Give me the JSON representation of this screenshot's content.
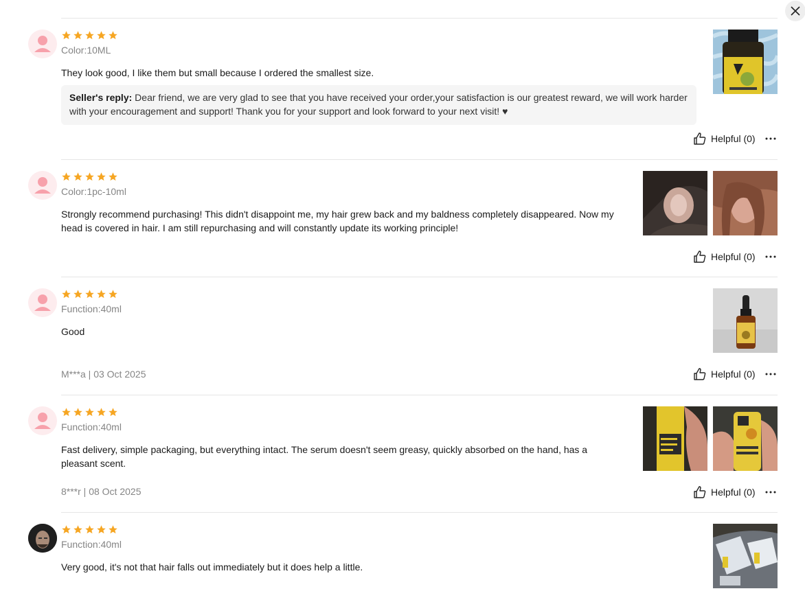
{
  "close_label": "close",
  "reviews": [
    {
      "rating": 5,
      "sku": "Color:10ML",
      "text": "They look good, I like them but small because I ordered the smallest size.",
      "reply_label": "Seller's reply:",
      "reply_text": "Dear friend, we are very glad to see that you have received your order,your satisfaction is our greatest reward, we will work harder with your encouragement and support! Thank you for your support and look forward to your next visit! ♥",
      "meta": "",
      "helpful": "Helpful (0)",
      "photos": [
        "bottle-on-blanket-photo"
      ]
    },
    {
      "rating": 5,
      "sku": "Color:1pc-10ml",
      "text_line1": "Strongly recommend purchasing! This didn't disappoint me, my hair grew back and my baldness completely disappeared. Now my",
      "text_line2": "head is covered in hair. I am still repurchasing and will constantly update its working principle!",
      "meta": "",
      "helpful": "Helpful (0)",
      "photos": [
        "scalp-photo",
        "hair-selfie-photo"
      ]
    },
    {
      "rating": 5,
      "sku": "Function:40ml",
      "text": "Good",
      "meta": "M***a | 03 Oct 2025",
      "helpful": "Helpful (0)",
      "photos": [
        "dropper-bottle-photo"
      ]
    },
    {
      "rating": 5,
      "sku": "Function:40ml",
      "text_line1": "Fast delivery, simple packaging, but everything intact. The serum doesn't seem greasy, quickly absorbed on the hand, has a",
      "text_line2": "pleasant scent.",
      "meta": "8***r | 08 Oct 2025",
      "helpful": "Helpful (0)",
      "photos": [
        "bottle-in-hand-photo",
        "bottle-label-photo"
      ]
    },
    {
      "rating": 5,
      "sku": "Function:40ml",
      "text": "Very good, it's not that hair falls out immediately but it does help a little.",
      "meta": "",
      "helpful": "",
      "photos": [
        "packaging-photo"
      ]
    }
  ],
  "colors": {
    "star": "#f6a623",
    "avatar_bg": "#fdecee",
    "avatar_fg": "#f7a1ab",
    "muted_text": "#858585",
    "reply_bg": "#f5f5f5",
    "divider": "#e5e5e5"
  }
}
